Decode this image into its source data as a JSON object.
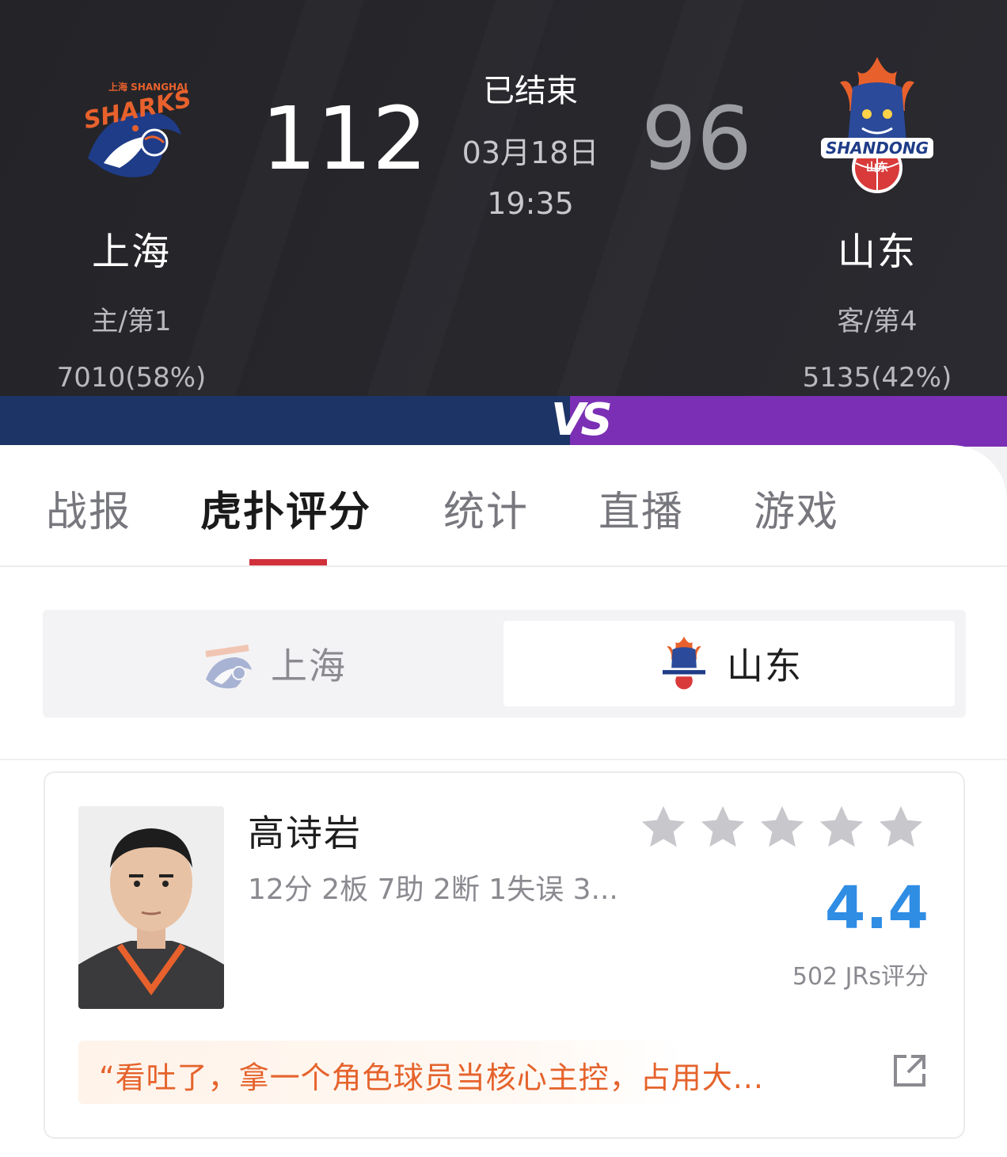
{
  "match": {
    "status": "已结束",
    "date": "03月18日",
    "time": "19:35",
    "vs_label": "VS",
    "home": {
      "name": "上海",
      "score": "112",
      "rank": "主/第1",
      "votes": "7010(58%)",
      "logo_text": "SHARKS",
      "logo_small": "上海 SHANGHAI"
    },
    "away": {
      "name": "山东",
      "score": "96",
      "rank": "客/第4",
      "votes": "5135(42%)",
      "logo_text": "SHANDONG",
      "logo_small": "山东"
    }
  },
  "tabs": [
    {
      "label": "战报",
      "active": false
    },
    {
      "label": "虎扑评分",
      "active": true
    },
    {
      "label": "统计",
      "active": false
    },
    {
      "label": "直播",
      "active": false
    },
    {
      "label": "游戏",
      "active": false
    }
  ],
  "team_switch": {
    "left_label": "上海",
    "right_label": "山东",
    "selected": "山东"
  },
  "player": {
    "name": "高诗岩",
    "stats": "12分 2板 7助 2断 1失误 3...",
    "stars_filled": 0,
    "stars_total": 5,
    "rating": "4.4",
    "raters": "502 JRs评分",
    "comment": "“看吐了，拿一个角色球员当核心主控，占用大..."
  },
  "colors": {
    "header_bg": "#262629",
    "home_bar": "#1d3466",
    "away_bar": "#7b2fb5",
    "active_tab_underline": "#d1313a",
    "rating": "#2f8de4",
    "comment_text": "#e5632c",
    "star_empty": "#c8c8cc"
  },
  "icons": {
    "star": "star-icon",
    "share": "external-link-icon"
  }
}
